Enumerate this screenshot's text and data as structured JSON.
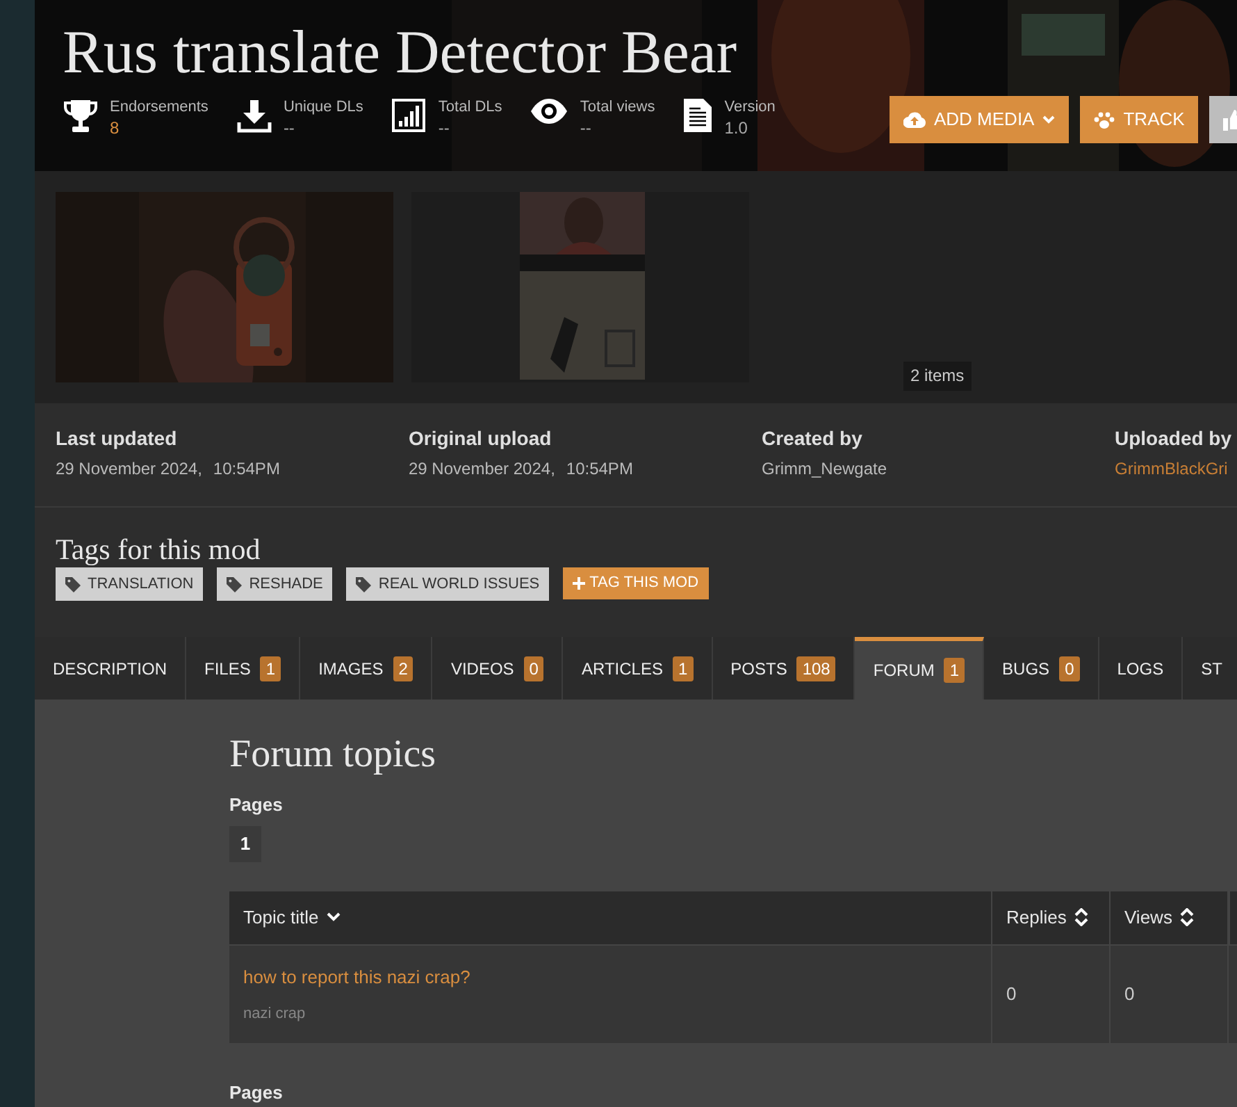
{
  "mod": {
    "title": "Rus translate Detector Bear"
  },
  "stats": [
    {
      "kind": "trophy",
      "label": "Endorsements",
      "value": "8",
      "highlight": true
    },
    {
      "kind": "download",
      "label": "Unique DLs",
      "value": "--",
      "highlight": false
    },
    {
      "kind": "chart",
      "label": "Total DLs",
      "value": "--",
      "highlight": false
    },
    {
      "kind": "eye",
      "label": "Total views",
      "value": "--",
      "highlight": false
    },
    {
      "kind": "document",
      "label": "Version",
      "value": "1.0",
      "highlight": false
    }
  ],
  "actions": [
    {
      "kind": "upload",
      "label": "ADD MEDIA",
      "dropdown": true
    },
    {
      "kind": "paw",
      "label": "TRACK",
      "dropdown": false
    },
    {
      "kind": "thumb"
    }
  ],
  "gallery": {
    "count": "2 items"
  },
  "info": [
    {
      "label": "Last updated",
      "date": "29 November 2024,",
      "time": "10:54PM",
      "link": false
    },
    {
      "label": "Original upload",
      "date": "29 November 2024,",
      "time": "10:54PM",
      "link": false
    },
    {
      "label": "Created by",
      "date": "Grimm_Newgate",
      "link": false
    },
    {
      "label": "Uploaded by",
      "date": "GrimmBlackGri",
      "link": true
    }
  ],
  "tags": {
    "heading": "Tags for this mod",
    "items": [
      "TRANSLATION",
      "RESHADE",
      "REAL WORLD ISSUES"
    ],
    "add": "TAG THIS MOD"
  },
  "tabs": [
    {
      "label": "DESCRIPTION",
      "selected": false
    },
    {
      "label": "FILES",
      "count": "1",
      "selected": false
    },
    {
      "label": "IMAGES",
      "count": "2",
      "selected": false
    },
    {
      "label": "VIDEOS",
      "count": "0",
      "selected": false
    },
    {
      "label": "ARTICLES",
      "count": "1",
      "selected": false
    },
    {
      "label": "POSTS",
      "count": "108",
      "selected": false
    },
    {
      "label": "FORUM",
      "count": "1",
      "selected": true
    },
    {
      "label": "BUGS",
      "count": "0",
      "selected": false
    },
    {
      "label": "LOGS",
      "selected": false
    },
    {
      "label": "ST",
      "selected": false
    }
  ],
  "forum": {
    "heading": "Forum topics",
    "pages_label": "Pages",
    "pages": [
      {
        "label": "1",
        "selected": true
      }
    ],
    "columns": [
      {
        "label": "Topic title",
        "kind": "descending"
      },
      {
        "label": "Replies",
        "kind": "sortable"
      },
      {
        "label": "Views",
        "kind": "sortable"
      }
    ],
    "rows": [
      {
        "title": "how to report this nazi crap?",
        "subtitle": "nazi crap",
        "replies": "0",
        "views": "0"
      }
    ],
    "pages_label_bottom": "Pages"
  }
}
